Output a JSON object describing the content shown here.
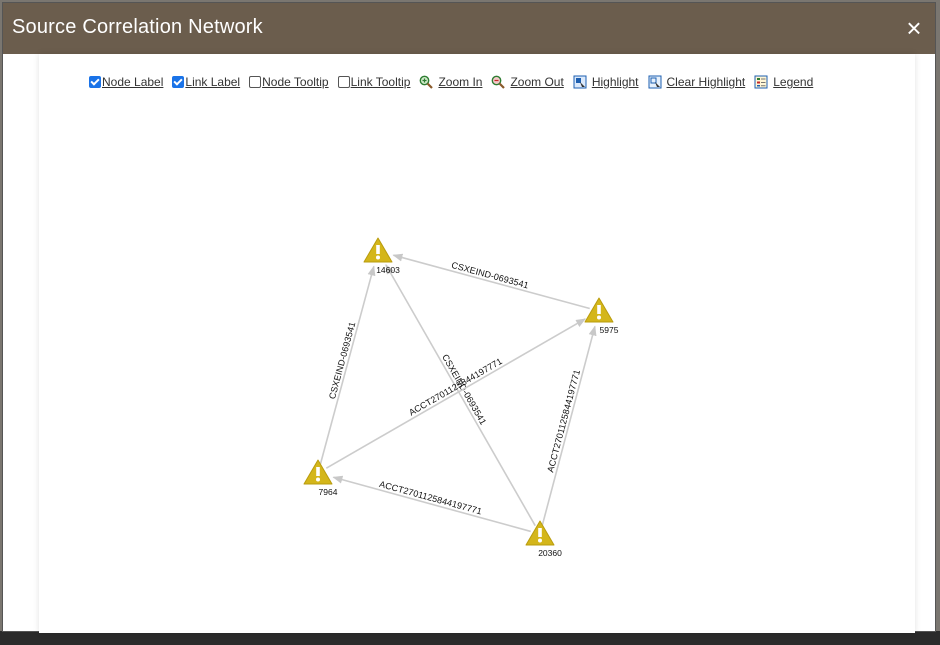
{
  "dialog": {
    "title": "Source Correlation Network",
    "close_symbol": "×"
  },
  "toolbar": {
    "node_label": {
      "label": "Node Label",
      "checked": true
    },
    "link_label": {
      "label": "Link Label",
      "checked": true
    },
    "node_tooltip": {
      "label": "Node Tooltip",
      "checked": false
    },
    "link_tooltip": {
      "label": "Link Tooltip",
      "checked": false
    },
    "zoom_in": {
      "label": "Zoom In",
      "icon": "zoom-in-icon"
    },
    "zoom_out": {
      "label": "Zoom Out",
      "icon": "zoom-out-icon"
    },
    "highlight": {
      "label": "Highlight",
      "icon": "highlight-icon"
    },
    "clear_highlight": {
      "label": "Clear Highlight",
      "icon": "clear-highlight-icon"
    },
    "legend": {
      "label": "Legend",
      "icon": "legend-icon"
    }
  },
  "network": {
    "node_icon": "warning-icon",
    "node_color": "#d4b61a",
    "link_color": "#cccccc",
    "nodes": [
      {
        "id": "14603",
        "label": "14603"
      },
      {
        "id": "5975",
        "label": "5975"
      },
      {
        "id": "7964",
        "label": "7964"
      },
      {
        "id": "20360",
        "label": "20360"
      }
    ],
    "links": [
      {
        "source": "5975",
        "target": "14603",
        "label": "CSXEIND-0693541"
      },
      {
        "source": "7964",
        "target": "14603",
        "label": "CSXEIND-0693541"
      },
      {
        "source": "20360",
        "target": "14603",
        "label": "CSXEIND-0693541"
      },
      {
        "source": "7964",
        "target": "5975",
        "label": "ACCT2701125844197771"
      },
      {
        "source": "20360",
        "target": "5975",
        "label": "ACCT2701125844197771"
      },
      {
        "source": "20360",
        "target": "7964",
        "label": "ACCT2701125844197771"
      }
    ]
  }
}
